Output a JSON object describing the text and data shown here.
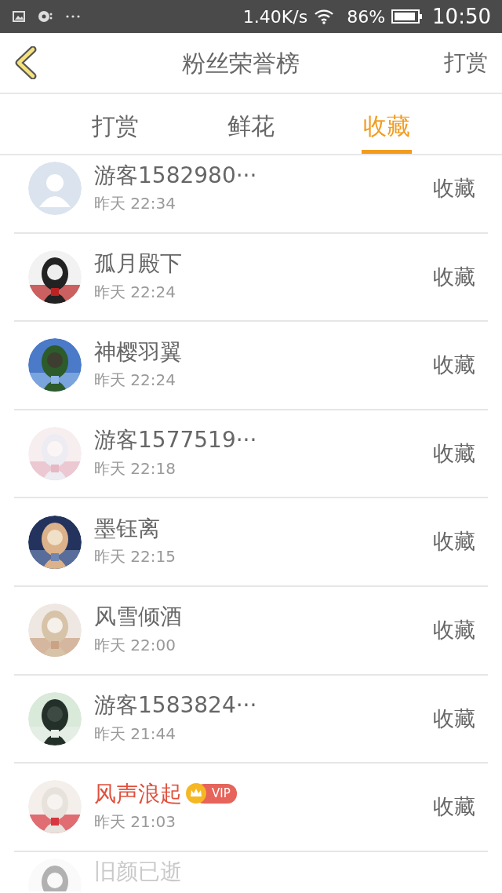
{
  "status_bar": {
    "speed": "1.40K/s",
    "battery": "86%",
    "time": "10:50"
  },
  "header": {
    "title": "粉丝荣誉榜",
    "action": "打赏"
  },
  "tabs": [
    {
      "label": "打赏",
      "selected": false
    },
    {
      "label": "鲜花",
      "selected": false
    },
    {
      "label": "收藏",
      "selected": true
    }
  ],
  "rows": [
    {
      "avatar": {
        "kind": "default"
      },
      "name": "游客1582980···",
      "time": "昨天 22:34",
      "action": "收藏"
    },
    {
      "name": "孤月殿下",
      "time": "昨天 22:24",
      "action": "收藏"
    },
    {
      "name": "神樱羽翼",
      "time": "昨天 22:24",
      "action": "收藏"
    },
    {
      "name": "游客1577519···",
      "time": "昨天 22:18",
      "action": "收藏"
    },
    {
      "name": "墨钰离",
      "time": "昨天 22:15",
      "action": "收藏"
    },
    {
      "name": "风雪倾酒",
      "time": "昨天 22:00",
      "action": "收藏"
    },
    {
      "name": "游客1583824···",
      "time": "昨天 21:44",
      "action": "收藏"
    },
    {
      "name": "风声浪起",
      "vip": "VIP",
      "time": "昨天 21:03",
      "action": "收藏"
    },
    {
      "name": "旧颜已逝",
      "faded": true
    }
  ]
}
